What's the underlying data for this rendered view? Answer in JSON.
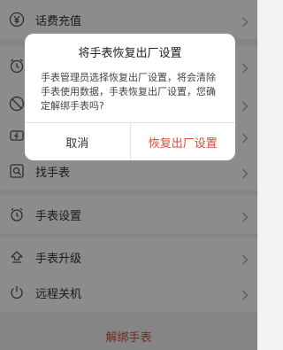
{
  "menu": {
    "items": [
      {
        "label": "话费充值",
        "icon": "yen-circle-icon"
      },
      {
        "label": "",
        "icon": "alarm-clock-icon"
      },
      {
        "label": "",
        "icon": "block-icon"
      },
      {
        "label": "",
        "icon": "flash-icon"
      },
      {
        "label": "找手表",
        "icon": "search-watch-icon"
      },
      {
        "label": "手表设置",
        "icon": "watch-settings-icon"
      },
      {
        "label": "手表升级",
        "icon": "upgrade-icon"
      },
      {
        "label": "远程关机",
        "icon": "power-icon"
      }
    ]
  },
  "unbind_label": "解绑手表",
  "dialog": {
    "title": "将手表恢复出厂设置",
    "message": "手表管理员选择恢复出厂设置，将会清除手表使用数据，手表恢复出厂设置，您确定解绑手表吗?",
    "cancel_label": "取消",
    "confirm_label": "恢复出厂设置"
  },
  "colors": {
    "accent": "#e0463c",
    "overlay": "rgba(0,0,0,0.45)",
    "background": "#f2f2f2"
  }
}
